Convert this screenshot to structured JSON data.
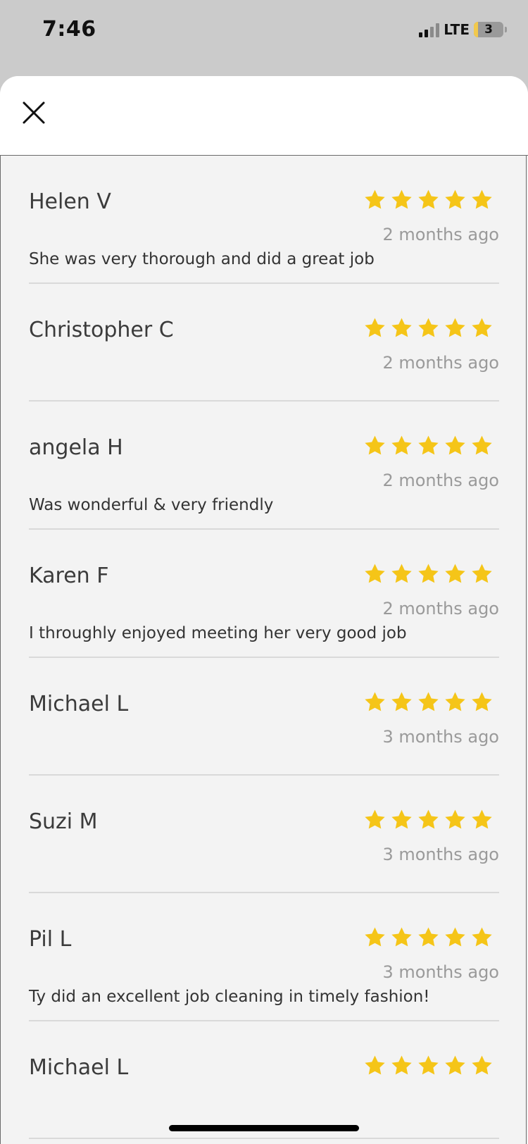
{
  "status_bar": {
    "time": "7:46",
    "network": "LTE",
    "battery": "3",
    "signal_bars": 2
  },
  "header": {
    "close_icon": "close-icon"
  },
  "colors": {
    "star": "#F5C518",
    "sheet_background": "#f3f3f3",
    "divider": "#d9d9d9"
  },
  "reviews": [
    {
      "name": "Helen V",
      "rating": 5,
      "time": "2 months ago",
      "comment": "She was very thorough and did a great job"
    },
    {
      "name": "Christopher C",
      "rating": 5,
      "time": "2 months ago",
      "comment": ""
    },
    {
      "name": "angela H",
      "rating": 5,
      "time": "2 months ago",
      "comment": "Was wonderful & very friendly"
    },
    {
      "name": "Karen F",
      "rating": 5,
      "time": "2 months ago",
      "comment": "I throughly enjoyed meeting her very good job"
    },
    {
      "name": "Michael L",
      "rating": 5,
      "time": "3 months ago",
      "comment": ""
    },
    {
      "name": "Suzi M",
      "rating": 5,
      "time": "3 months ago",
      "comment": ""
    },
    {
      "name": "Pil L",
      "rating": 5,
      "time": "3 months ago",
      "comment": "Ty did an excellent job cleaning in timely fashion!"
    },
    {
      "name": "Michael L",
      "rating": 5,
      "time": "",
      "comment": ""
    }
  ]
}
